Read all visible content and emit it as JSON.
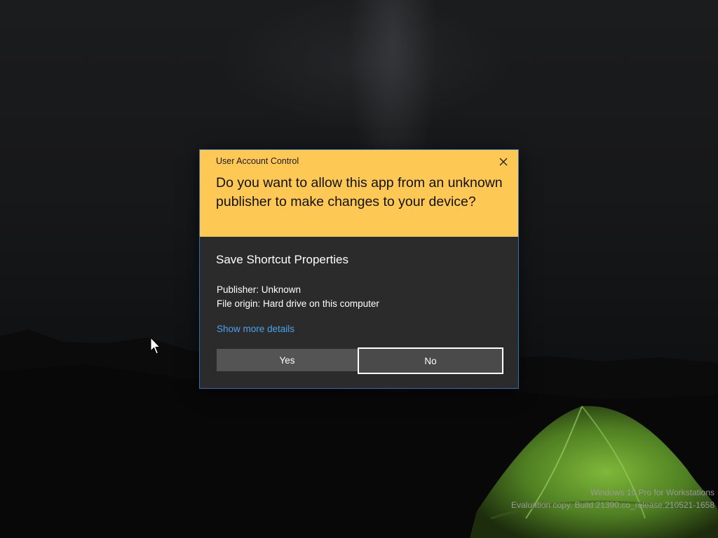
{
  "dialog": {
    "title": "User Account Control",
    "question": "Do you want to allow this app from an unknown publisher to make changes to your device?",
    "app_name": "Save Shortcut Properties",
    "publisher": "Publisher: Unknown",
    "file_origin": "File origin: Hard drive on this computer",
    "details_link": "Show more details",
    "yes_label": "Yes",
    "no_label": "No",
    "close_icon": "close-icon",
    "header_color": "#fdc854",
    "body_color": "#2b2b2b",
    "link_color": "#4aa3ec"
  },
  "watermark": {
    "line1": "Windows 10 Pro for Workstations",
    "line2": "Evaluation copy. Build 21390.co_release.210521-1658"
  },
  "cursor": "arrow-cursor-icon"
}
